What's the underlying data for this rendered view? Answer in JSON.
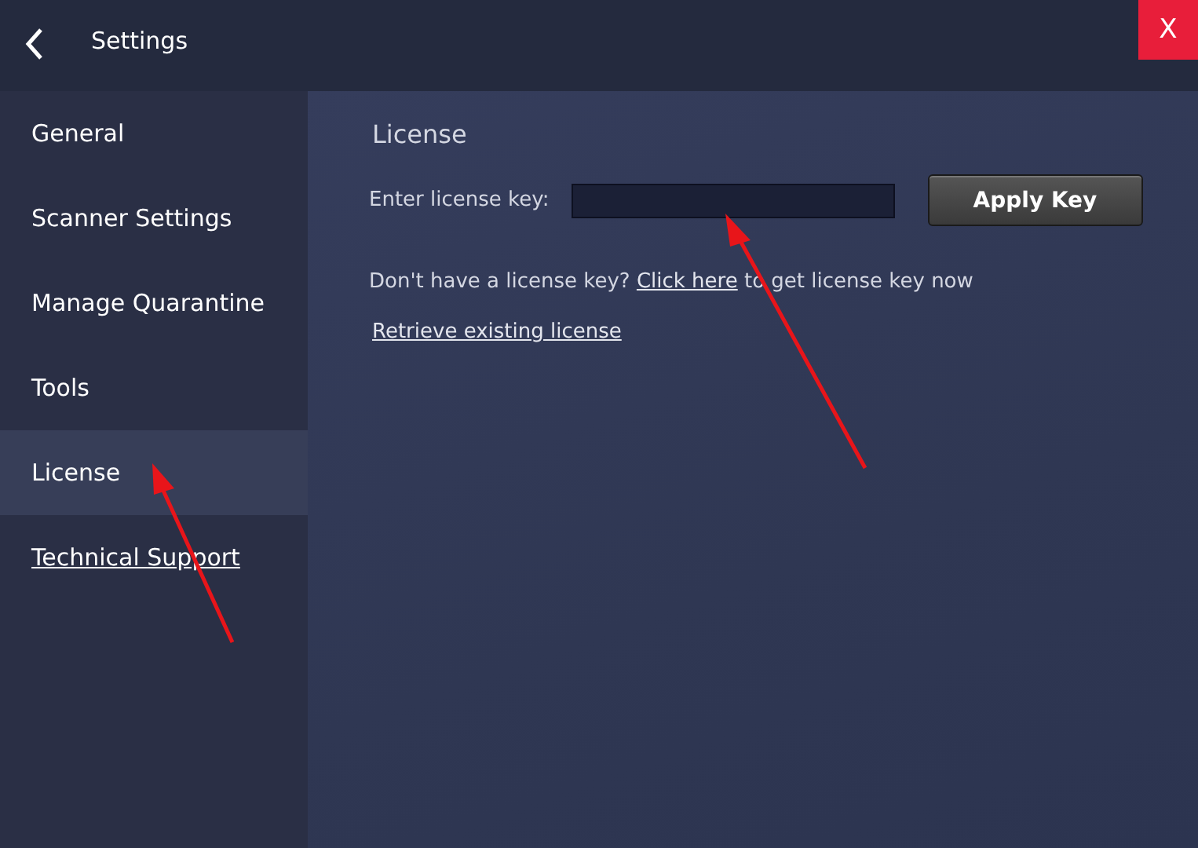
{
  "window": {
    "title": "Settings",
    "close": "X"
  },
  "sidebar": {
    "items": [
      {
        "label": "General",
        "kind": "page",
        "selected": false
      },
      {
        "label": "Scanner Settings",
        "kind": "page",
        "selected": false
      },
      {
        "label": "Manage Quarantine",
        "kind": "page",
        "selected": false
      },
      {
        "label": "Tools",
        "kind": "page",
        "selected": false
      },
      {
        "label": "License",
        "kind": "page",
        "selected": true
      },
      {
        "label": "Technical Support",
        "kind": "link",
        "selected": false
      }
    ]
  },
  "license": {
    "heading": "License",
    "key_label": "Enter license key:",
    "apply_button": "Apply Key",
    "prompt": {
      "before": "Don't have a license key?",
      "link": "Click here",
      "after": "to get license key now"
    },
    "retrieve_link": "Retrieve existing license"
  }
}
